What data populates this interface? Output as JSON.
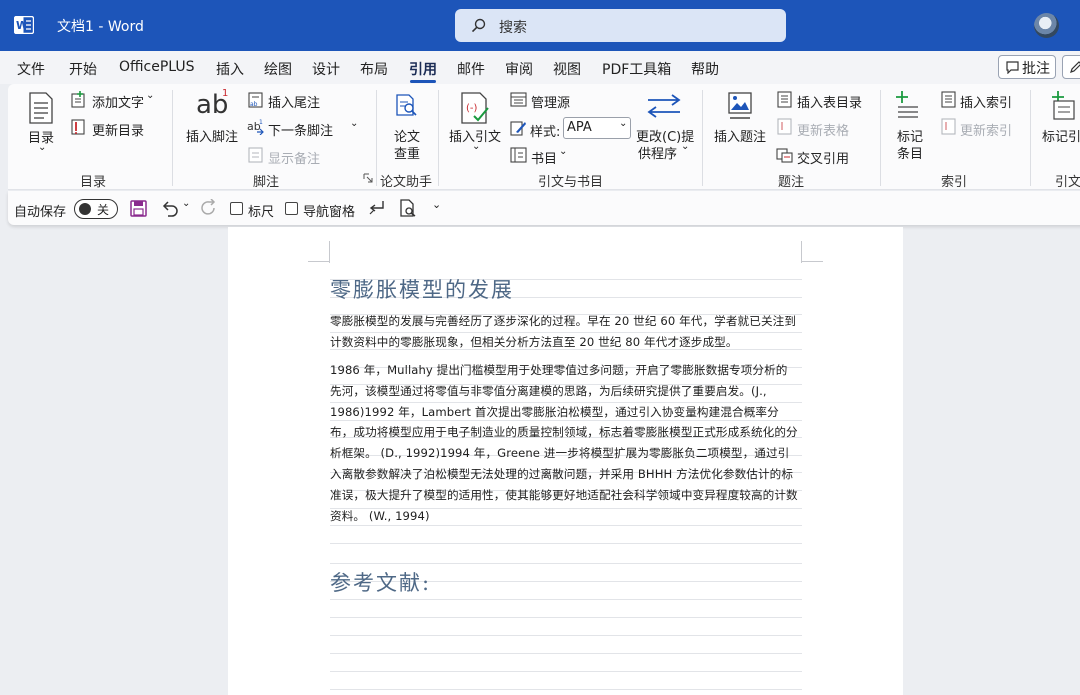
{
  "titlebar": {
    "doc_title": "文档1  -  Word",
    "search_label": "搜索"
  },
  "menu": {
    "tabs": [
      "文件",
      "开始",
      "OfficePLUS",
      "插入",
      "绘图",
      "设计",
      "布局",
      "引用",
      "邮件",
      "审阅",
      "视图",
      "PDF工具箱",
      "帮助"
    ],
    "active_tab": "引用",
    "comment_button": "批注"
  },
  "ribbon": {
    "toc": {
      "big_button": "目录",
      "add_text": "添加文字",
      "update_toc": "更新目录",
      "group_label": "目录"
    },
    "footnote": {
      "big_button": "插入脚注",
      "icon_text": "ab",
      "icon_sup": "1",
      "insert_endnote": "插入尾注",
      "next_footnote": "下一条脚注",
      "show_notes": "显示备注",
      "group_label": "脚注"
    },
    "paper": {
      "big_button_line1": "论文",
      "big_button_line2": "查重",
      "group_label": "论文助手"
    },
    "citations": {
      "insert_citation": "插入引文",
      "manage_sources": "管理源",
      "style_label": "样式:",
      "style_value": "APA",
      "bibliography": "书目",
      "change_provider_line1": "更改(C)提",
      "change_provider_line2": "供程序",
      "group_label": "引文与书目"
    },
    "captions": {
      "insert_caption": "插入题注",
      "insert_table_of_figures": "插入表目录",
      "update_table": "更新表格",
      "cross_reference": "交叉引用",
      "group_label": "题注"
    },
    "index": {
      "mark_entry_line1": "标记",
      "mark_entry_line2": "条目",
      "insert_index": "插入索引",
      "update_index": "更新索引",
      "group_label": "索引"
    },
    "toa": {
      "mark_citation": "标记引",
      "group_label": "引文"
    }
  },
  "quick_access": {
    "autosave_label": "自动保存",
    "autosave_state": "关",
    "ruler": "标尺",
    "nav_pane": "导航窗格"
  },
  "document": {
    "heading1": "零膨胀模型的发展",
    "para1": "零膨胀模型的发展与完善经历了逐步深化的过程。早在 20 世纪 60 年代，学者就已关注到计数资料中的零膨胀现象，但相关分析方法直至 20 世纪 80 年代才逐步成型。",
    "para2": "1986 年，Mullahy 提出门槛模型用于处理零值过多问题，开启了零膨胀数据专项分析的先河，该模型通过将零值与非零值分离建模的思路，为后续研究提供了重要启发。(J., 1986)1992 年，Lambert 首次提出零膨胀泊松模型，通过引入协变量构建混合概率分布，成功将模型应用于电子制造业的质量控制领域，标志着零膨胀模型正式形成系统化的分析框架。 (D., 1992)1994 年，Greene 进一步将模型扩展为零膨胀负二项模型，通过引入离散参数解决了泊松模型无法处理的过离散问题，并采用 BHHH 方法优化参数估计的标准误，极大提升了模型的适用性，使其能够更好地适配社会科学领域中变异程度较高的计数资料。 (W., 1994)",
    "heading2": "参考文献:"
  }
}
